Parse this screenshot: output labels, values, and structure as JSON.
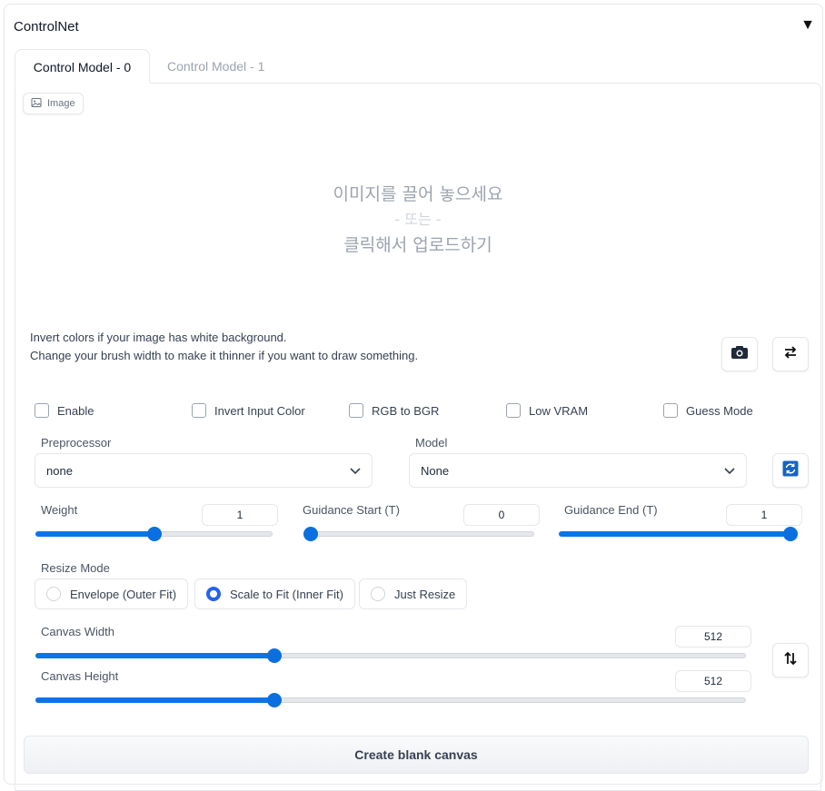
{
  "panel": {
    "title": "ControlNet"
  },
  "tabs": [
    {
      "label": "Control Model - 0",
      "active": true
    },
    {
      "label": "Control Model - 1",
      "active": false
    }
  ],
  "image_input": {
    "chip_label": "Image",
    "drop_text": "이미지를 끌어 놓으세요",
    "or_text": "- 또는 -",
    "click_text": "클릭해서 업로드하기"
  },
  "hints": [
    "Invert colors if your image has white background.",
    "Change your brush width to make it thinner if you want to draw something."
  ],
  "checkboxes": [
    {
      "label": "Enable",
      "checked": false
    },
    {
      "label": "Invert Input Color",
      "checked": false
    },
    {
      "label": "RGB to BGR",
      "checked": false
    },
    {
      "label": "Low VRAM",
      "checked": false
    },
    {
      "label": "Guess Mode",
      "checked": false
    }
  ],
  "preprocessor": {
    "label": "Preprocessor",
    "value": "none"
  },
  "model": {
    "label": "Model",
    "value": "None"
  },
  "sliders": {
    "weight": {
      "label": "Weight",
      "value": "1",
      "fraction": 0.5
    },
    "guidance_start": {
      "label": "Guidance Start (T)",
      "value": "0",
      "fraction": 0.0
    },
    "guidance_end": {
      "label": "Guidance End (T)",
      "value": "1",
      "fraction": 1.0
    },
    "canvas_width": {
      "label": "Canvas Width",
      "value": "512",
      "fraction": 0.333
    },
    "canvas_height": {
      "label": "Canvas Height",
      "value": "512",
      "fraction": 0.333
    }
  },
  "resize_mode": {
    "label": "Resize Mode",
    "options": [
      "Envelope (Outer Fit)",
      "Scale to Fit (Inner Fit)",
      "Just Resize"
    ],
    "selected": "Scale to Fit (Inner Fit)"
  },
  "create_button": "Create blank canvas",
  "colors": {
    "accent": "#0b75e8",
    "radio_selected": "#2563eb",
    "border": "#e5e7eb"
  },
  "icons": [
    "image-icon",
    "camera-icon",
    "swap-horizontal-icon",
    "chevron-down-icon",
    "refresh-icon",
    "swap-vertical-icon",
    "triangle-down-icon"
  ]
}
